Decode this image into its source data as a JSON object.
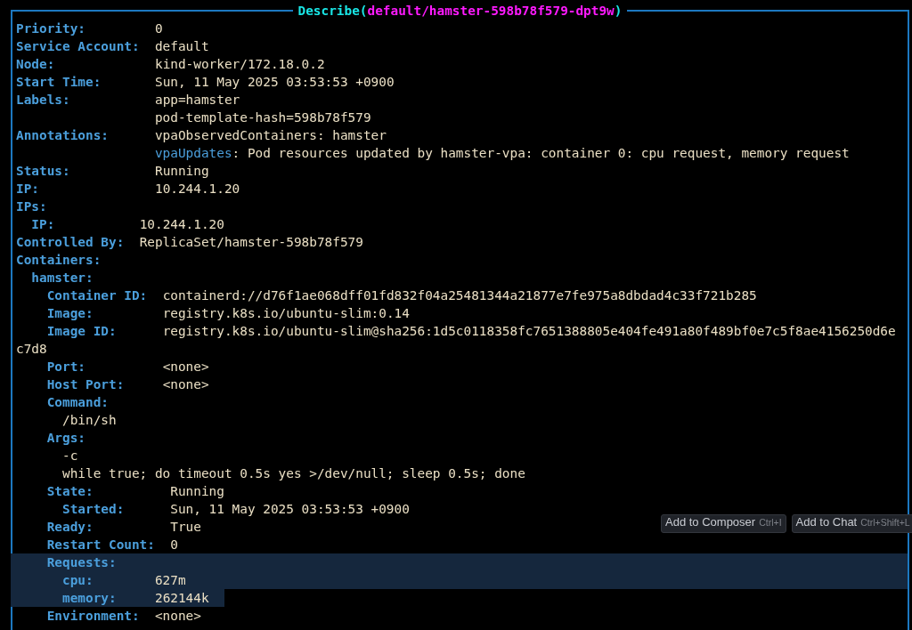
{
  "title": {
    "prefix": "Describe(",
    "target": "default/hamster-598b78f579-dpt9w",
    "suffix": ")"
  },
  "fields": [
    {
      "kind": "field",
      "key": "Priority:",
      "value": "0",
      "selected": false
    },
    {
      "kind": "field",
      "key": "Service Account:",
      "value": "default",
      "selected": false
    },
    {
      "kind": "field",
      "key": "Node:",
      "value": "kind-worker/172.18.0.2",
      "selected": false
    },
    {
      "kind": "field",
      "key": "Start Time:",
      "value": "Sun, 11 May 2025 03:53:53 +0900",
      "selected": false
    },
    {
      "kind": "field",
      "key": "Labels:",
      "value": "app=hamster",
      "selected": false
    },
    {
      "kind": "cont",
      "value": "pod-template-hash=598b78f579",
      "selected": false
    },
    {
      "kind": "field",
      "key": "Annotations:",
      "value": "vpaObservedContainers: hamster",
      "selected": false
    },
    {
      "kind": "cont",
      "subkey": "vpaUpdates",
      "value": ": Pod resources updated by hamster-vpa: container 0: cpu request, memory request",
      "selected": false
    },
    {
      "kind": "field",
      "key": "Status:",
      "value": "Running",
      "selected": false
    },
    {
      "kind": "field",
      "key": "IP:",
      "value": "10.244.1.20",
      "selected": false
    },
    {
      "kind": "field",
      "key": "IPs:",
      "selected": false,
      "children": [
        {
          "kind": "field",
          "key": "IP:",
          "value": "10.244.1.20",
          "selected": false
        }
      ]
    },
    {
      "kind": "field",
      "key": "Controlled By:",
      "value": "ReplicaSet/hamster-598b78f579",
      "selected": false
    },
    {
      "kind": "field",
      "key": "Containers:",
      "selected": false,
      "children": [
        {
          "kind": "field",
          "key": "hamster:",
          "selected": false,
          "children": [
            {
              "kind": "field",
              "key": "Container ID:",
              "value": "containerd://d76f1ae068dff01fd832f04a25481344a21877e7fe975a8dbdad4c33f721b285",
              "selected": false
            },
            {
              "kind": "field",
              "key": "Image:",
              "value": "registry.k8s.io/ubuntu-slim:0.14",
              "selected": false
            },
            {
              "kind": "field",
              "key": "Image ID:",
              "value": "registry.k8s.io/ubuntu-slim@sha256:1d5c0118358fc7651388805e404fe491a80f489bf0e7c5f8ae4156250d6e",
              "selected": false
            },
            {
              "kind": "wrap",
              "value": "c7d8",
              "selected": false
            },
            {
              "kind": "field",
              "key": "Port:",
              "value": "<none>",
              "selected": false
            },
            {
              "kind": "field",
              "key": "Host Port:",
              "value": "<none>",
              "selected": false
            },
            {
              "kind": "field",
              "key": "Command:",
              "selected": false,
              "children": [
                {
                  "kind": "item",
                  "value": "/bin/sh",
                  "selected": false
                }
              ]
            },
            {
              "kind": "field",
              "key": "Args:",
              "selected": false,
              "children": [
                {
                  "kind": "item",
                  "value": "-c",
                  "selected": false
                },
                {
                  "kind": "item",
                  "value": "while true; do timeout 0.5s yes >/dev/null; sleep 0.5s; done",
                  "selected": false
                }
              ]
            },
            {
              "kind": "field",
              "key": "State:",
              "value": "Running",
              "selected": false,
              "children": [
                {
                  "kind": "field",
                  "key": "Started:",
                  "value": "Sun, 11 May 2025 03:53:53 +0900",
                  "selected": false
                }
              ]
            },
            {
              "kind": "field",
              "key": "Ready:",
              "value": "True",
              "selected": false
            },
            {
              "kind": "field",
              "key": "Restart Count:",
              "value": "0",
              "selected": false
            },
            {
              "kind": "field",
              "key": "Requests:",
              "selected": true,
              "children": [
                {
                  "kind": "field",
                  "key": "cpu:",
                  "value": "627m",
                  "selected": true
                },
                {
                  "kind": "field",
                  "key": "memory:",
                  "value": "262144k",
                  "selected": true
                }
              ]
            },
            {
              "kind": "field",
              "key": "Environment:",
              "value": "<none>",
              "selected": false
            }
          ]
        }
      ]
    }
  ],
  "actions": [
    {
      "label": "Add to Composer",
      "shortcut": "Ctrl+I"
    },
    {
      "label": "Add to Chat",
      "shortcut": "Ctrl+Shift+L"
    }
  ]
}
